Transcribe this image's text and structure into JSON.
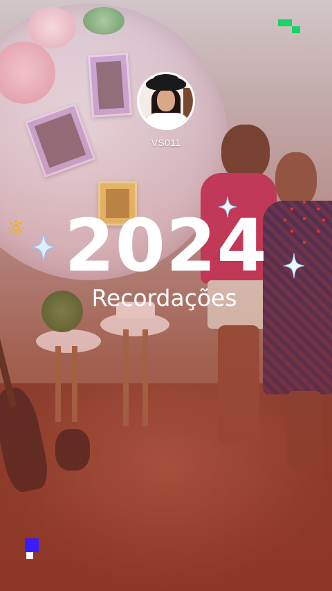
{
  "profile": {
    "username": "VS011",
    "avatar_icon": "profile-photo-icon"
  },
  "title": {
    "year": "2024",
    "subtitle": "Recordações"
  },
  "decorations": {
    "sparkle_color": "#cfe8ff",
    "sun_color": "#f2b400",
    "dots_color": "#ff2a2a",
    "pixel_top_color": "#19d36b",
    "pixel_bottom_color": "#3b1cff"
  }
}
